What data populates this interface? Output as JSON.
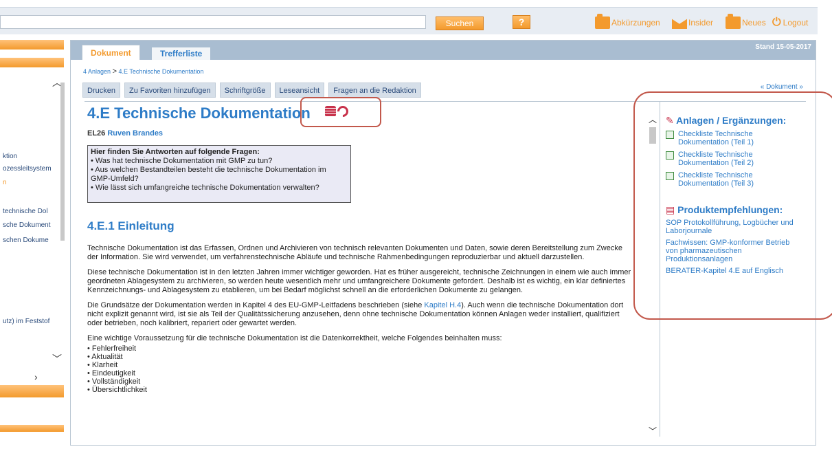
{
  "topbar": {
    "search_button": "Suchen",
    "help_button": "?",
    "nav": [
      {
        "label": "Abkürzungen",
        "icon": "folder-icon"
      },
      {
        "label": "Insider",
        "icon": "envelope-icon"
      },
      {
        "label": "Neues",
        "icon": "folder-icon"
      },
      {
        "label": "Logout",
        "icon": "power-icon"
      }
    ]
  },
  "left": {
    "items": [
      "ktion",
      "ozessleitsystem",
      "n",
      "technische Dol",
      "sche Dokument",
      "schen Dokume",
      "utz) im Feststof"
    ]
  },
  "main": {
    "tabs": [
      "Dokument",
      "Trefferliste"
    ],
    "stand": "Stand 15-05-2017",
    "breadcrumb_1": "4 Anlagen",
    "breadcrumb_sep": ">",
    "breadcrumb_2": "4.E Technische Dokumentation",
    "toolbar": [
      "Drucken",
      "Zu Favoriten hinzufügen",
      "Schriftgröße",
      "Leseansicht",
      "Fragen an die Redaktion"
    ],
    "dok_link": "« Dokument »",
    "title": "4.E Technische Dokumentation",
    "author_code": "EL26",
    "author_name": "Ruven Brandes",
    "questions_heading": "Hier finden Sie Antworten auf folgende Fragen:",
    "questions": [
      "• Was hat technische Dokumentation mit GMP zu tun?",
      "• Aus welchen Bestandteilen besteht die technische Dokumentation im GMP-Umfeld?",
      "• Wie lässt sich umfangreiche technische Dokumentation verwalten?"
    ],
    "h2": "4.E.1 Einleitung",
    "p1": "Technische Dokumentation ist das Erfassen, Ordnen und Archivieren von technisch relevanten Dokumenten und Daten, sowie deren Bereitstellung zum Zwecke der Information. Sie wird verwendet, um verfahrenstechnische Abläufe und technische Rahmenbedingungen reproduzierbar und aktuell darzustellen.",
    "p2": "Diese technische Dokumentation ist in den letzten Jahren immer wichtiger geworden. Hat es früher ausgereicht, technische Zeichnungen in einem wie auch immer geordneten Ablagesystem zu archivieren, so werden heute wesentlich mehr und umfangreichere Dokumente gefordert. Deshalb ist es wichtig, ein klar definiertes Kennzeichnungs- und Ablagesystem zu etablieren, um bei Bedarf möglichst schnell an die erforderlichen Dokumente zu gelangen.",
    "p3_a": "Die Grundsätze der Dokumentation werden in Kapitel 4 des EU-GMP-Leitfadens beschrieben (siehe ",
    "p3_link": "Kapitel H.4",
    "p3_b": "). Auch wenn die technische Dokumentation dort nicht explizit genannt wird, ist sie als Teil der Qualitätssicherung anzusehen, denn ohne technische Dokumentation können Anlagen weder installiert, qualifiziert oder betrieben, noch kalibriert, repariert oder gewartet werden.",
    "p4": "Eine wichtige Voraussetzung für die technische Dokumentation ist die Datenkorrektheit, welche Folgendes beinhalten muss:",
    "list": [
      "• Fehlerfreiheit",
      "• Aktualität",
      "• Klarheit",
      "• Eindeutigkeit",
      "• Vollständigkeit",
      "• Übersichtlichkeit"
    ]
  },
  "sidebar": {
    "anlagen_heading": "Anlagen / Ergänzungen:",
    "anlagen": [
      "Checkliste Technische Dokumentation (Teil 1)",
      "Checkliste Technische Dokumentation (Teil 2)",
      "Checkliste Technische Dokumentation (Teil 3)"
    ],
    "produkt_heading": "Produktempfehlungen:",
    "produkte": [
      "SOP Protokollführung, Logbücher und Laborjournale",
      "Fachwissen: GMP-konformer Betrieb von pharmazeutischen Produktionsanlagen",
      "BERATER-Kapitel 4.E auf Englisch"
    ]
  }
}
